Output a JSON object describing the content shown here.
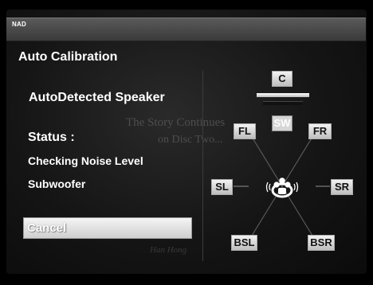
{
  "header": {
    "brand": "NAD"
  },
  "page": {
    "title": "Auto Calibration"
  },
  "main": {
    "section_label": "AutoDetected Speaker",
    "status_label": "Status :",
    "status_lines": [
      "Checking Noise Level",
      "Subwoofer"
    ]
  },
  "actions": {
    "cancel_label": "Cancel"
  },
  "watermark": {
    "line1": "The Story Continues",
    "line2": "on Disc Two...",
    "line3": "Han Hong"
  },
  "speakers": {
    "center": "C",
    "subwoofer": "SW",
    "front_left": "FL",
    "front_right": "FR",
    "surround_left": "SL",
    "surround_right": "SR",
    "back_left": "BSL",
    "back_right": "BSR",
    "active": "SW"
  },
  "colors": {
    "background": "#000000",
    "panel": "#1a1a1a",
    "topbar": "#4a4a4a",
    "text": "#ffffff",
    "button": "#e6e6e6"
  }
}
